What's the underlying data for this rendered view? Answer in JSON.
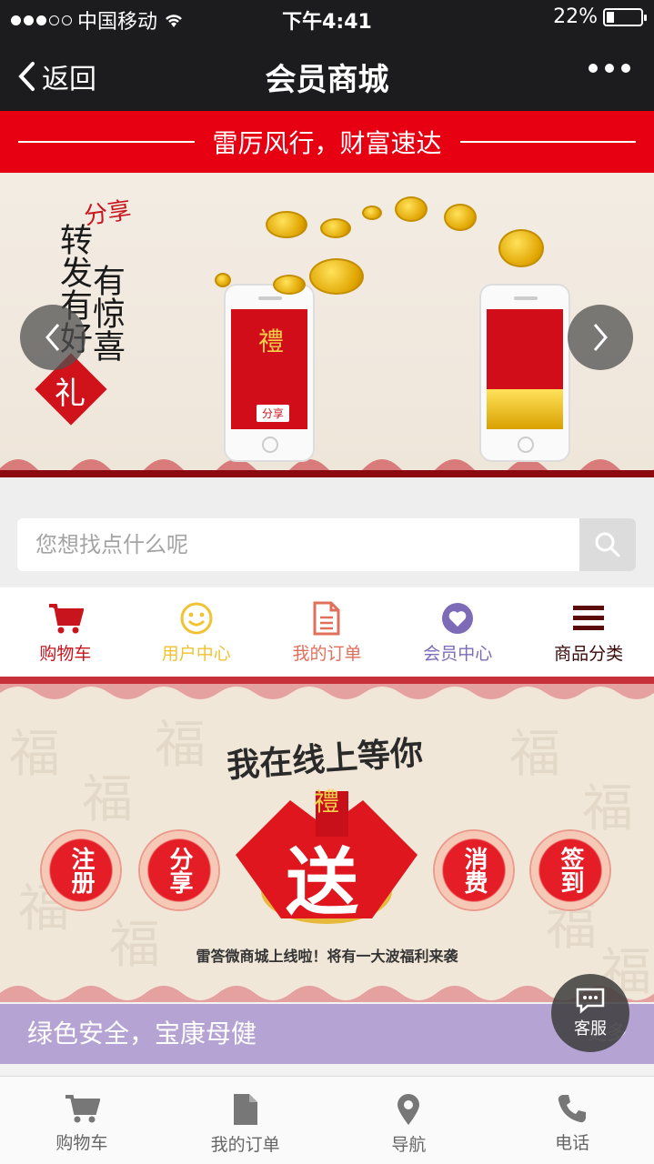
{
  "status_bar": {
    "carrier": "中国移动",
    "time": "下午4:41",
    "battery": "22%",
    "battery_level": 0.22
  },
  "nav": {
    "back_label": "返回",
    "title": "会员商城"
  },
  "slogan": "雷厉风行，财富速达",
  "banner": {
    "col1": "有惊喜",
    "col2": "转发有好",
    "seal": "礼",
    "sign": "分享",
    "phone_left_char": "禮",
    "phone_left_btn": "分享"
  },
  "search": {
    "placeholder": "您想找点什么呢"
  },
  "menu": [
    {
      "label": "购物车",
      "color": "#c8141c"
    },
    {
      "label": "用户中心",
      "color": "#f1c232"
    },
    {
      "label": "我的订单",
      "color": "#e0705b"
    },
    {
      "label": "会员中心",
      "color": "#7d6bb8"
    },
    {
      "label": "商品分类",
      "color": "#5a0a0a"
    }
  ],
  "promo": {
    "title": "我在线上等你",
    "buttons": [
      "注册",
      "分享",
      "消费",
      "签到"
    ],
    "center": "送",
    "top_char": "禮",
    "caption": "雷答微商城上线啦！将有一大波福利来袭"
  },
  "section": {
    "title": "绿色安全，宝康母健",
    "more": "更多"
  },
  "chat": {
    "label": "客服"
  },
  "tabs": [
    {
      "label": "购物车"
    },
    {
      "label": "我的订单"
    },
    {
      "label": "导航"
    },
    {
      "label": "电话"
    }
  ],
  "colors": {
    "brand_red": "#e60012",
    "nav_bg": "#1c1c1e",
    "purple": "#b5a4d3"
  }
}
